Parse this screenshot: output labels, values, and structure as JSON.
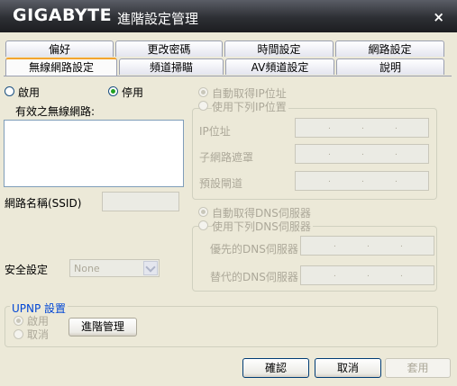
{
  "window": {
    "brand": "GIGABYTE",
    "title": "進階設定管理",
    "close": "×"
  },
  "tabs_row1": [
    "偏好",
    "更改密碼",
    "時間設定",
    "網路設定"
  ],
  "tabs_row2": [
    "無線網路設定",
    "頻道掃瞄",
    "AV頻道設定",
    "說明"
  ],
  "active_tab": "無線網路設定",
  "wireless": {
    "enable_label": "啟用",
    "disable_label": "停用",
    "selected": "停用",
    "networks_label": "有效之無線網路:",
    "ssid_label": "網路名稱(SSID)",
    "ssid_value": "",
    "security_label": "安全設定",
    "security_value": "None"
  },
  "ip": {
    "auto_label": "自動取得IP位址",
    "manual_label": "使用下列IP位置",
    "ip_label": "IP位址",
    "mask_label": "子網路遮罩",
    "gateway_label": "預設閘道"
  },
  "dns": {
    "auto_label": "自動取得DNS伺服器",
    "manual_label": "使用下列DNS伺服器",
    "preferred_label": "優先的DNS伺服器",
    "alternate_label": "替代的DNS伺服器"
  },
  "upnp": {
    "group_label": "UPNP 設置",
    "enable_label": "啟用",
    "cancel_label": "取消",
    "advanced_button": "進階管理"
  },
  "buttons": {
    "ok": "確認",
    "cancel": "取消",
    "apply": "套用"
  },
  "colors": {
    "titlebar": "#2d2f34",
    "tab_highlight": "#f3a430",
    "group_title": "#0046d5"
  }
}
